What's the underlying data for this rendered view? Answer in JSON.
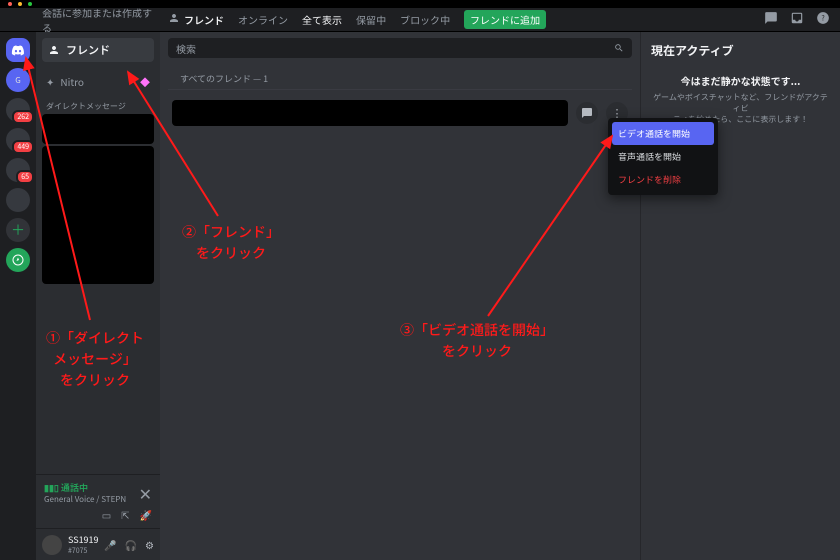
{
  "mac_dots": [
    "#ff5f57",
    "#febc2e",
    "#28c840"
  ],
  "titlebar": {
    "title": "会話に参加または作成する",
    "friends_label": "フレンド",
    "tabs": {
      "online": "オンライン",
      "all": "全て表示",
      "pending": "保留中",
      "blocked": "ブロック中"
    },
    "add_friend": "フレンドに追加"
  },
  "rail": {
    "badges": [
      "262",
      "449",
      "65"
    ]
  },
  "dm": {
    "friends": "フレンド",
    "nitro": "Nitro",
    "header": "ダイレクトメッセージ",
    "voice_status": "通話中",
    "voice_channel": "General Voice / STEPN",
    "user_name": "SS1919",
    "user_tag": "#7075"
  },
  "main": {
    "search_placeholder": "検索",
    "list_header": "すべてのフレンド — 1"
  },
  "context_menu": {
    "video": "ビデオ通話を開始",
    "voice": "音声通話を開始",
    "remove": "フレンドを削除"
  },
  "right": {
    "title": "現在アクティブ",
    "subtitle": "今はまだ静かな状態です...",
    "desc1": "ゲームやボイスチャットなど、フレンドがアクティビ",
    "desc2": "ティを始めたら、ここに表示します！"
  },
  "annotations": {
    "a1_l1": "①「ダイレクト",
    "a1_l2": "メッセージ」",
    "a1_l3": "をクリック",
    "a2_l1": "②「フレンド」",
    "a2_l2": "をクリック",
    "a3_l1": "③「ビデオ通話を開始」",
    "a3_l2": "をクリック"
  }
}
